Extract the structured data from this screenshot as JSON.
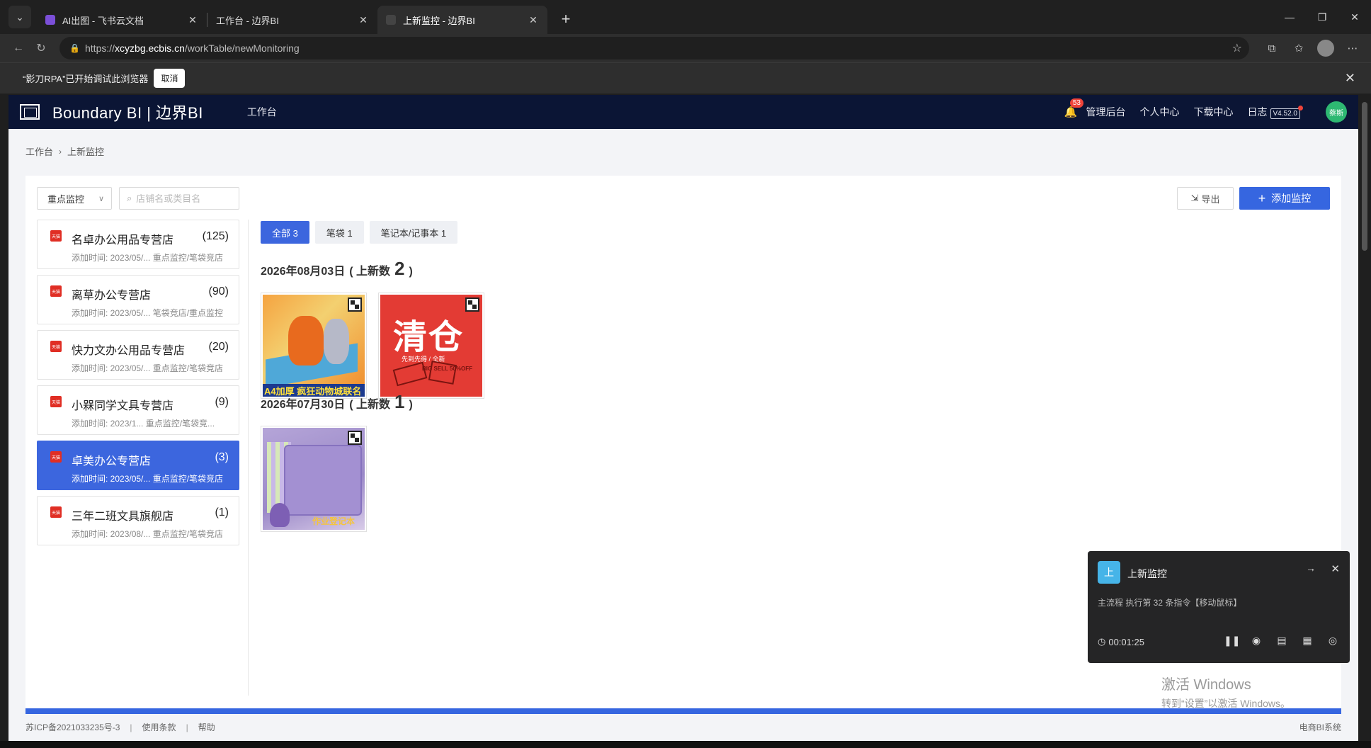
{
  "browser": {
    "tabs": [
      {
        "title": "AI出图 - 飞书云文档",
        "active": false,
        "favicon_color": "#7b4fd8"
      },
      {
        "title": "工作台 - 边界BI",
        "active": false,
        "favicon_color": "#2a2a2a"
      },
      {
        "title": "上新监控 - 边界BI",
        "active": true,
        "favicon_color": "#444444"
      }
    ],
    "url_prefix": "https://",
    "url_domain": "xcyzbg.ecbis.cn",
    "url_path": "/workTable/newMonitoring",
    "debug_notice": "“影刀RPA”已开始调试此浏览器",
    "debug_cancel": "取消"
  },
  "app": {
    "brand": "Boundary BI | 边界BI",
    "nav_workbench": "工作台",
    "notif_count": "53",
    "header_links": [
      "管理后台",
      "个人中心",
      "下载中心",
      "日志"
    ],
    "version": "V4.52.0",
    "user_initials": "蔡斯"
  },
  "breadcrumb": [
    "工作台",
    "上新监控"
  ],
  "filters": {
    "select_value": "重点监控",
    "search_placeholder": "店铺名或类目名",
    "export_label": "导出",
    "add_label": "添加监控"
  },
  "stores": [
    {
      "name": "名卓办公用品专营店",
      "count": "(125)",
      "meta": "添加时间: 2023/05/... 重点监控/笔袋竞店",
      "active": false
    },
    {
      "name": "离草办公专营店",
      "count": "(90)",
      "meta": "添加时间: 2023/05/... 笔袋竞店/重点监控",
      "active": false
    },
    {
      "name": "快力文办公用品专营店",
      "count": "(20)",
      "meta": "添加时间: 2023/05/... 重点监控/笔袋竞店",
      "active": false
    },
    {
      "name": "小槑同学文具专营店",
      "count": "(9)",
      "meta": "添加时间: 2023/1... 重点监控/笔袋竞...",
      "active": false
    },
    {
      "name": "卓美办公专营店",
      "count": "(3)",
      "meta": "添加时间: 2023/05/... 重点监控/笔袋竞店",
      "active": true
    },
    {
      "name": "三年二班文具旗舰店",
      "count": "(1)",
      "meta": "添加时间: 2023/08/... 重点监控/笔袋竞店",
      "active": false
    }
  ],
  "store_badge": "天猫",
  "chips": [
    {
      "label": "全部 3",
      "active": true
    },
    {
      "label": "笔袋 1",
      "active": false
    },
    {
      "label": "笔记本/记事本 1",
      "active": false
    }
  ],
  "groups": [
    {
      "date": "2026年08月03日",
      "label_open": "( 上新数",
      "count": "2",
      "label_close": ")"
    },
    {
      "date": "2026年07月30日",
      "label_open": "( 上新数",
      "count": "1",
      "label_close": ")"
    }
  ],
  "products": {
    "p1_caption": "A4加厚 疯狂动物城联名",
    "p2_title": "清仓",
    "p2_sub": "先到先得 / 全新",
    "p2_tag": "BIG SELL 50%OFF",
    "p3_caption": "作业登记本"
  },
  "footer": {
    "icp": "苏ICP备2021033235号-3",
    "terms": "使用条款",
    "help": "帮助",
    "right": "电商BI系统"
  },
  "rpa": {
    "icon_char": "上",
    "title": "上新监控",
    "status": "主流程 执行第 32 条指令【移动鼠标】",
    "time": "00:01:25"
  },
  "os_notice": {
    "line1": "激活 Windows",
    "line2": "转到“设置”以激活 Windows。"
  }
}
